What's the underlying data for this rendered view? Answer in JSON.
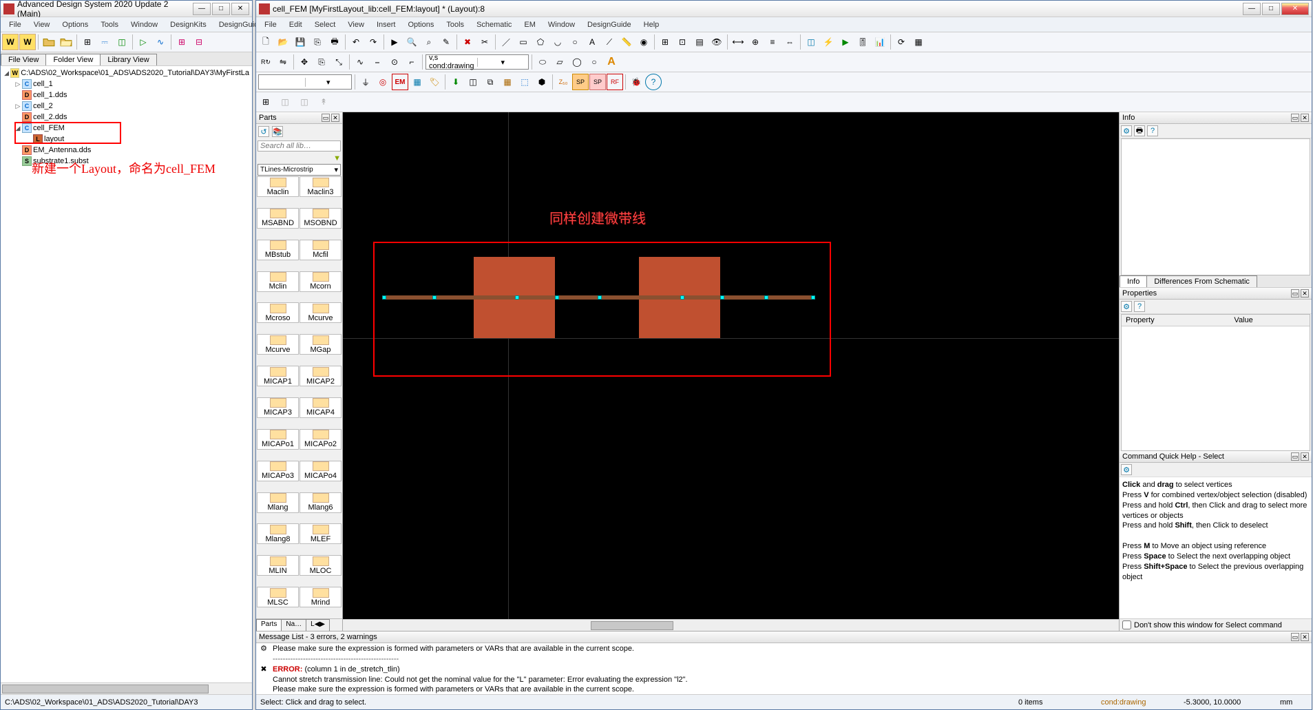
{
  "main_win": {
    "title": "Advanced Design System 2020 Update 2 (Main)",
    "menus": [
      "File",
      "View",
      "Options",
      "Tools",
      "Window",
      "DesignKits",
      "DesignGuide"
    ],
    "tabs_top": [
      "File View",
      "Folder View",
      "Library View"
    ],
    "active_tab": 1,
    "tree_root": "C:\\ADS\\02_Workspace\\01_ADS\\ADS2020_Tutorial\\DAY3\\MyFirstLa",
    "tree": [
      {
        "ind": 1,
        "tog": "▷",
        "ic": "c",
        "label": "cell_1"
      },
      {
        "ind": 1,
        "tog": "",
        "ic": "d",
        "label": "cell_1.dds"
      },
      {
        "ind": 1,
        "tog": "▷",
        "ic": "c",
        "label": "cell_2"
      },
      {
        "ind": 1,
        "tog": "",
        "ic": "d",
        "label": "cell_2.dds"
      },
      {
        "ind": 1,
        "tog": "◢",
        "ic": "c",
        "label": "cell_FEM",
        "hl": true
      },
      {
        "ind": 2,
        "tog": "",
        "ic": "l",
        "label": "layout",
        "hl": true
      },
      {
        "ind": 1,
        "tog": "",
        "ic": "d",
        "label": "EM_Antenna.dds"
      },
      {
        "ind": 1,
        "tog": "",
        "ic": "s",
        "label": "substrate1.subst"
      }
    ],
    "annotation": "新建一个Layout，命名为cell_FEM",
    "status": "C:\\ADS\\02_Workspace\\01_ADS\\ADS2020_Tutorial\\DAY3"
  },
  "layout_win": {
    "title": "cell_FEM [MyFirstLayout_lib:cell_FEM:layout] * (Layout):8",
    "menus": [
      "File",
      "Edit",
      "Select",
      "View",
      "Insert",
      "Options",
      "Tools",
      "Schematic",
      "EM",
      "Window",
      "DesignGuide",
      "Help"
    ],
    "layer_combo": "v,s cond:drawing",
    "component_combo": "",
    "parts": {
      "title": "Parts",
      "search_ph": "Search all lib…",
      "category": "TLines-Microstrip",
      "items": [
        "Maclin",
        "Maclin3",
        "MSABND",
        "MSOBND",
        "MBstub",
        "Mcfil",
        "Mclin",
        "Mcorn",
        "Mcroso",
        "Mcurve",
        "Mcurve",
        "MGap",
        "MICAP1",
        "MICAP2",
        "MICAP3",
        "MICAP4",
        "MICAPo1",
        "MICAPo2",
        "MICAPo3",
        "MICAPo4",
        "Mlang",
        "Mlang6",
        "Mlang8",
        "MLEF",
        "MLIN",
        "MLOC",
        "MLSC",
        "Mrind"
      ],
      "bottom_tabs": [
        "Parts",
        "Na…",
        "L◀▶"
      ]
    },
    "canvas_annotation": "同样创建微带线",
    "info": {
      "title": "Info",
      "tabs": [
        "Info",
        "Differences From Schematic"
      ]
    },
    "properties": {
      "title": "Properties",
      "cols": [
        "Property",
        "Value"
      ]
    },
    "quickhelp": {
      "title": "Command Quick Help - Select",
      "lines": [
        {
          "t": "<b>Click</b> and <b>drag</b> to select vertices"
        },
        {
          "t": "Press <b>V</b> for combined vertex/object selection (disabled)"
        },
        {
          "t": "Press and hold <b>Ctrl</b>, then Click and drag to select more vertices or objects"
        },
        {
          "t": "Press and hold <b>Shift</b>, then Click to deselect"
        },
        {
          "t": ""
        },
        {
          "t": "Press <b>M</b> to Move an object using reference"
        },
        {
          "t": "Press <b>Space</b> to Select the next overlapping object"
        },
        {
          "t": "Press <b>Shift+Space</b> to Select the previous overlapping object"
        }
      ],
      "checkbox": "Don't show this window for Select command"
    },
    "messages": {
      "title": "Message List - 3 errors, 2 warnings",
      "lines": [
        {
          "ic": "⚙",
          "cls": "",
          "text": "Please make sure the expression is formed with parameters or VARs that are available in the current scope."
        },
        {
          "ic": "",
          "cls": "hr-dash",
          "text": "--------------------------------------------------"
        },
        {
          "ic": "✖",
          "cls": "",
          "text": "<span class='err'>ERROR:</span> (column 1 in de_stretch_tlin)"
        },
        {
          "ic": "",
          "cls": "",
          "text": "Cannot stretch transmission line: Could not get the nominal value for the \"L\" parameter: Error evaluating the expression \"l2\"."
        },
        {
          "ic": "",
          "cls": "",
          "text": "Please make sure the expression is formed with parameters or VARs that are available in the current scope."
        }
      ]
    },
    "status": {
      "left": "Select: Click and drag to select.",
      "items": "0 items",
      "layer": "cond:drawing",
      "coords": "-5.3000, 10.0000",
      "extra": "",
      "unit": "mm"
    }
  }
}
